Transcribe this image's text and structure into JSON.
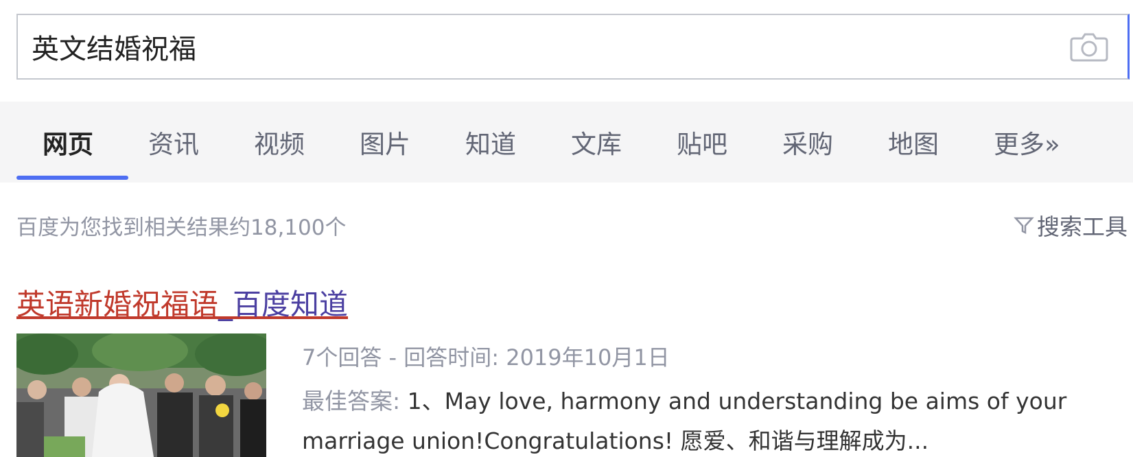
{
  "search": {
    "query": "英文结婚祝福"
  },
  "tabs": [
    {
      "label": "网页",
      "active": true
    },
    {
      "label": "资讯",
      "active": false
    },
    {
      "label": "视频",
      "active": false
    },
    {
      "label": "图片",
      "active": false
    },
    {
      "label": "知道",
      "active": false
    },
    {
      "label": "文库",
      "active": false
    },
    {
      "label": "贴吧",
      "active": false
    },
    {
      "label": "采购",
      "active": false
    },
    {
      "label": "地图",
      "active": false
    },
    {
      "label": "更多»",
      "active": false
    }
  ],
  "results_info": {
    "count_text": "百度为您找到相关结果约18,100个",
    "tools_label": "搜索工具"
  },
  "result": {
    "title_part1": "英语新婚祝福语",
    "title_part2": "_百度知道",
    "meta": "7个回答 - 回答时间: 2019年10月1日",
    "snippet_label": "最佳答案: ",
    "snippet_text": "1、May love, harmony and understanding be aims of your marriage union!Congratulations! 愿爱、和谐与理解成为..."
  },
  "colors": {
    "accent": "#4e6ef2",
    "title_red": "#c0392b",
    "muted": "#9195a3"
  },
  "icons": {
    "camera": "camera-icon",
    "filter": "filter-icon"
  }
}
